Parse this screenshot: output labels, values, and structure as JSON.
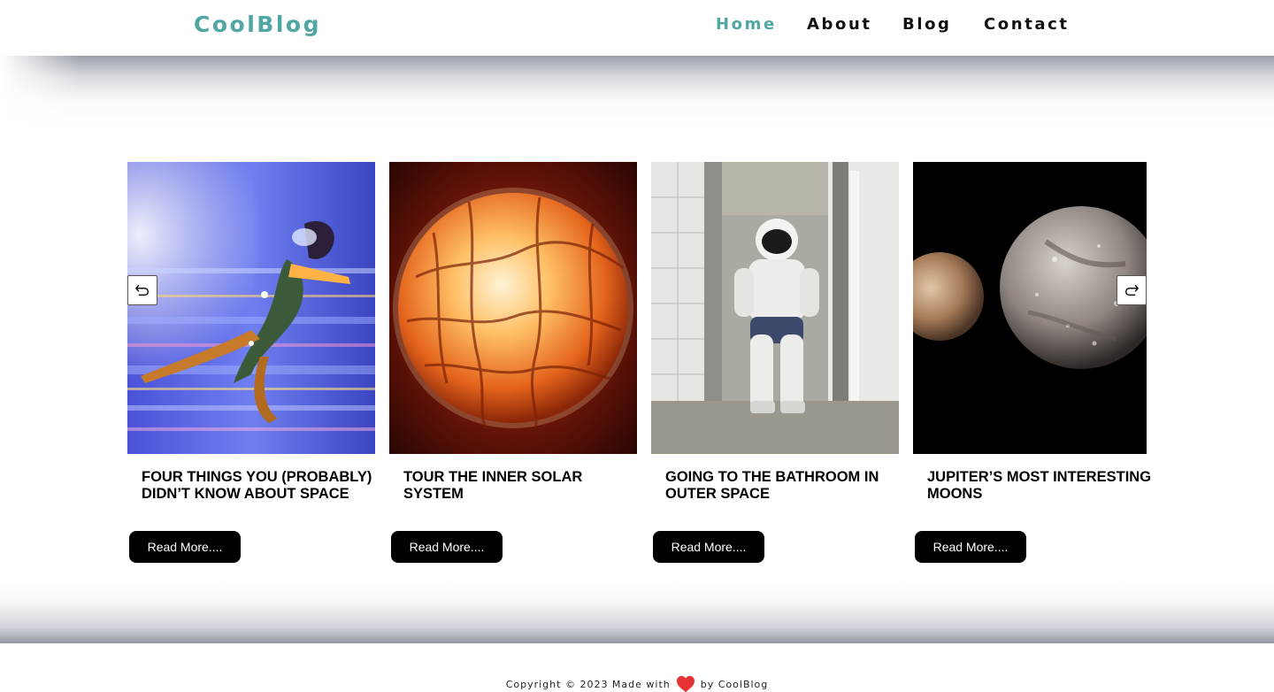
{
  "header": {
    "logo": "CoolBlog",
    "nav": [
      "Home",
      "About",
      "Blog",
      "Contact"
    ],
    "active_nav": "Home",
    "brand_color": "#4fa6a3"
  },
  "carousel": {
    "prev_icon": "undo-arrow-icon",
    "next_icon": "redo-arrow-icon",
    "posts": [
      {
        "title": "FOUR THINGS YOU (PROBABLY) DIDN’T KNOW ABOUT SPACE",
        "button": "Read More....",
        "image": "running-cyber-woman-image"
      },
      {
        "title": "TOUR THE INNER SOLAR SYSTEM",
        "button": "Read More....",
        "image": "glowing-sphere-image"
      },
      {
        "title": "GOING TO THE BATHROOM IN OUTER SPACE",
        "button": "Read More....",
        "image": "astronaut-bathroom-image"
      },
      {
        "title": "JUPITER’S MOST INTERESTING MOONS",
        "button": "Read More....",
        "image": "jupiter-moons-image"
      }
    ]
  },
  "footer": {
    "before": "Copyright © 2023 Made with",
    "icon": "heart-icon",
    "after": "by CoolBlog",
    "heart_color": "#e63232"
  }
}
